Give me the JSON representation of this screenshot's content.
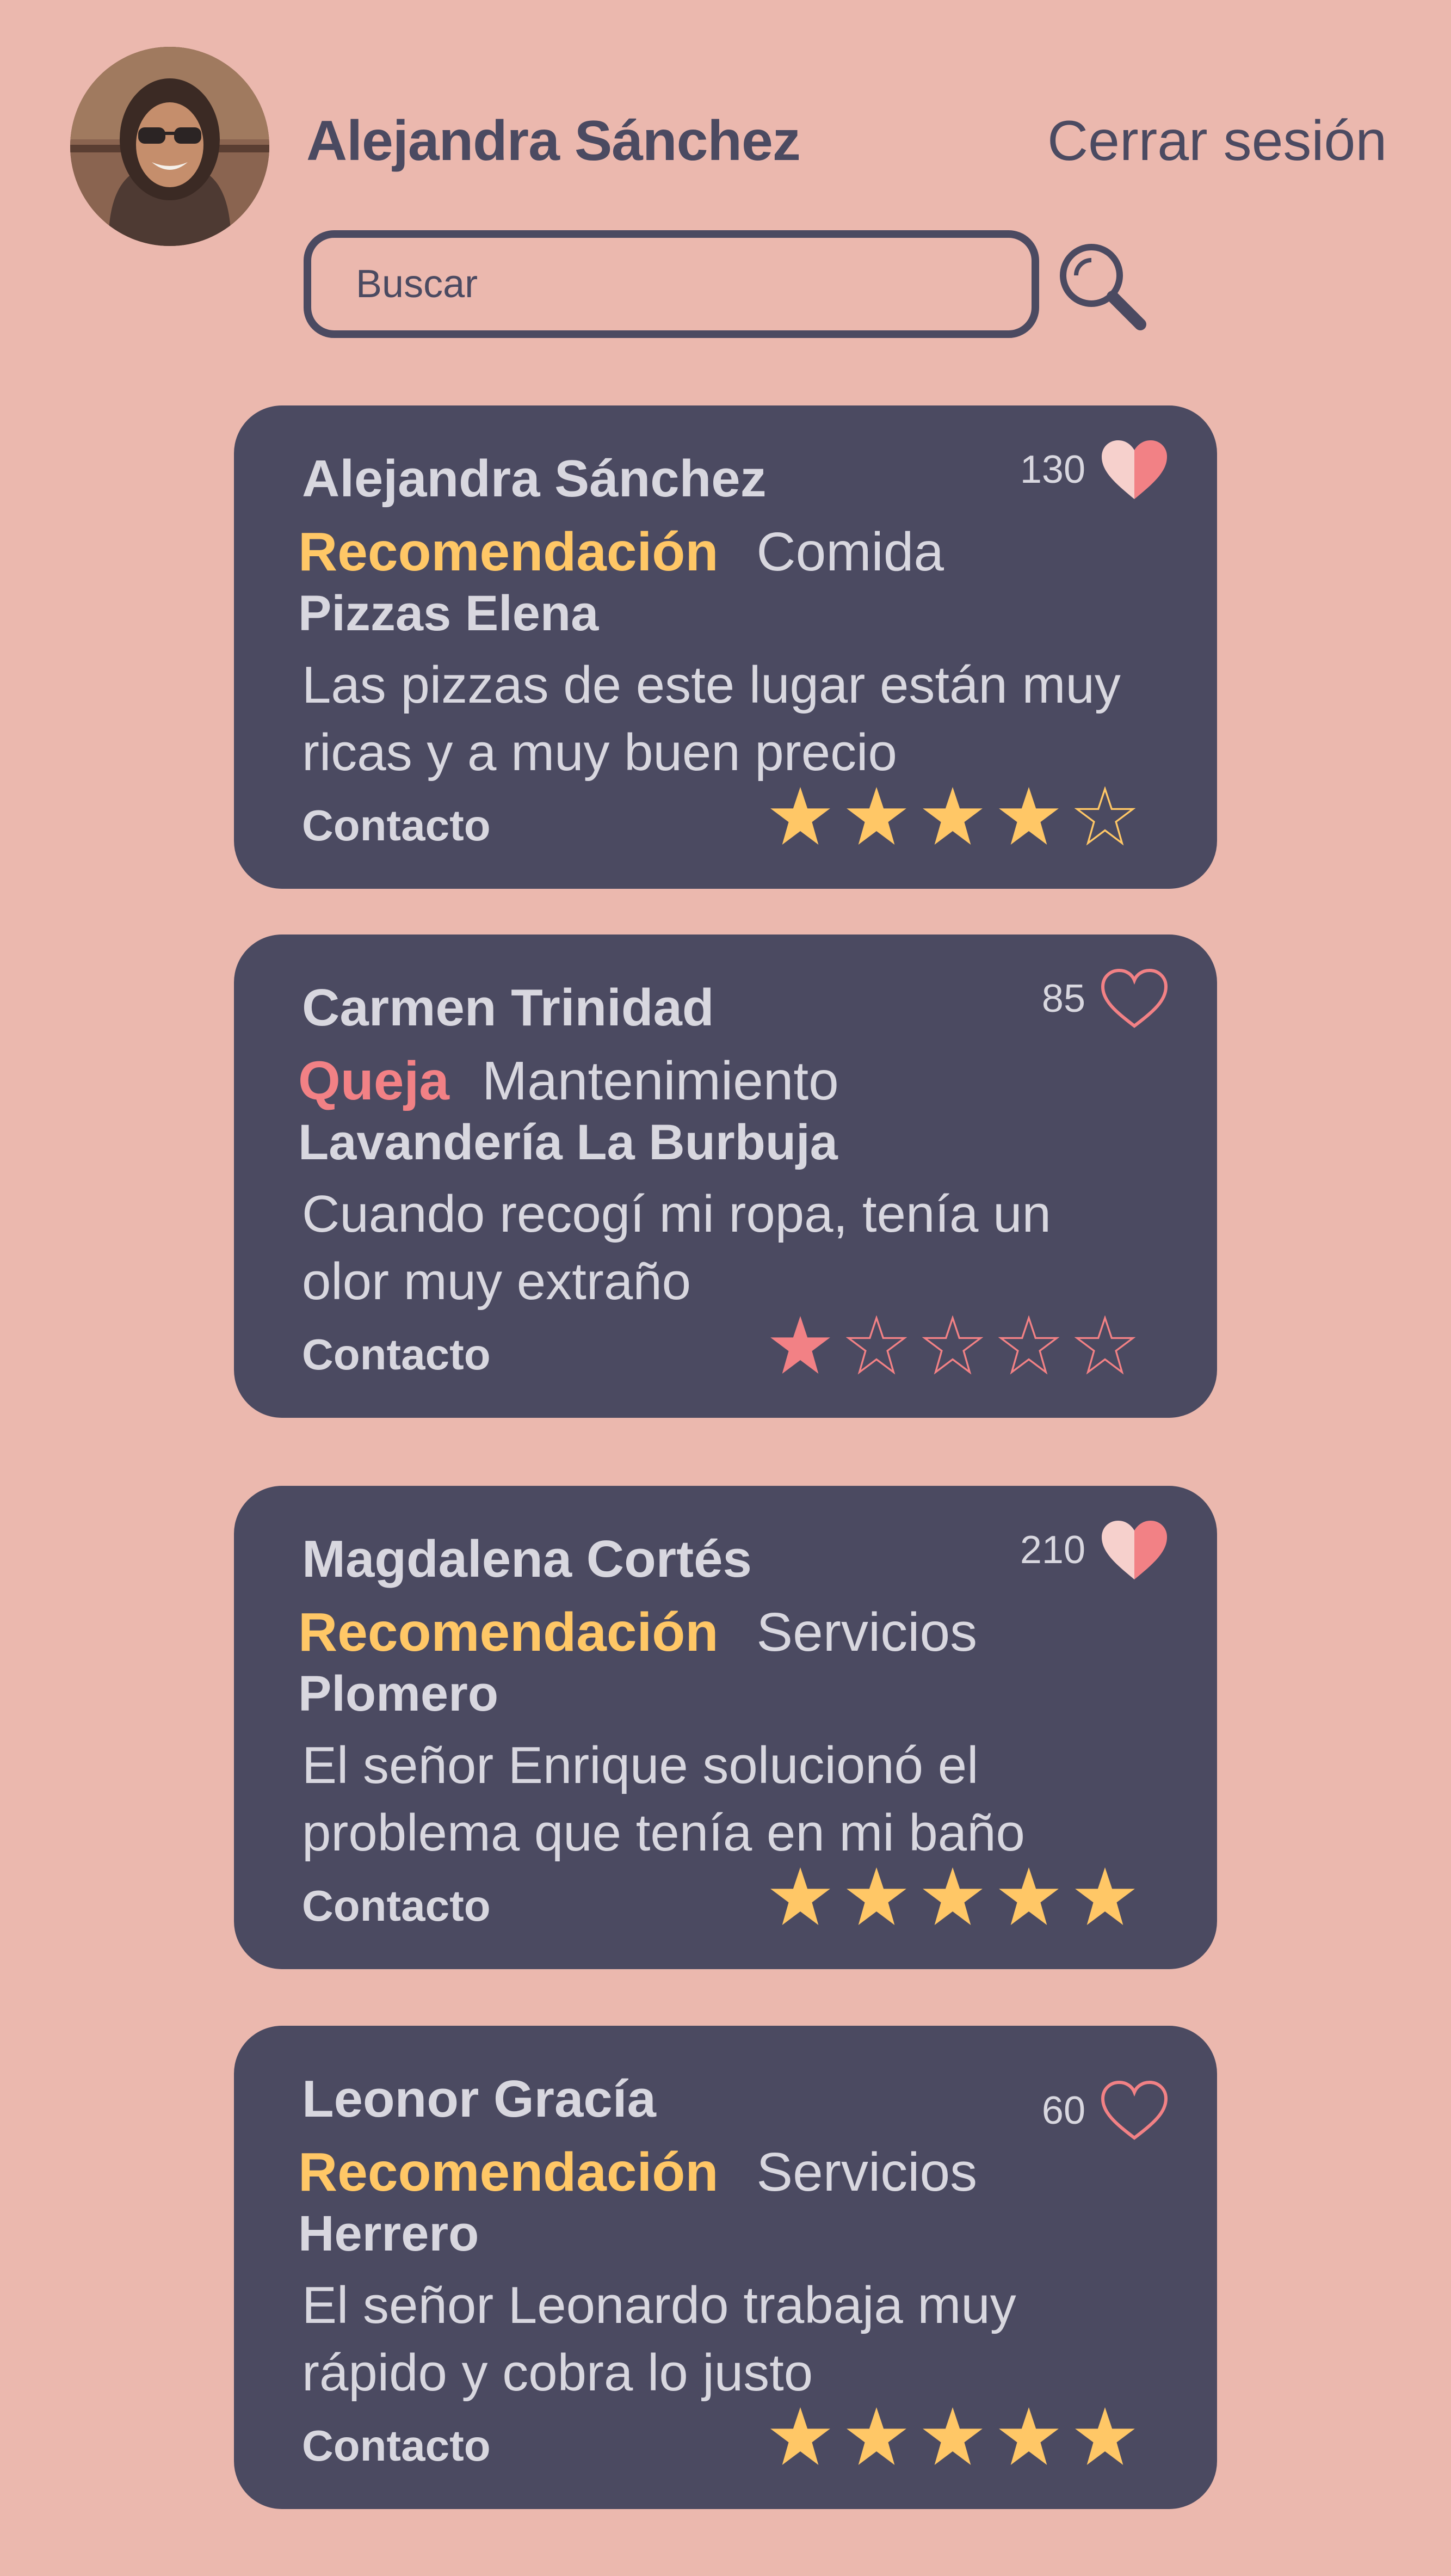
{
  "header": {
    "user_name": "Alejandra Sánchez",
    "logout_label": "Cerrar sesión"
  },
  "search": {
    "placeholder": "Buscar"
  },
  "colors": {
    "background": "#ebb8ae",
    "card": "#4b4a61",
    "recommendation": "#ffc766",
    "complaint": "#f28185",
    "card_text": "#d8d7df"
  },
  "posts": [
    {
      "author": "Alejandra Sánchez",
      "likes": "130",
      "liked": true,
      "type": "Recomendación",
      "category": "Comida",
      "business": "Pizzas Elena",
      "text": "Las pizzas de este lugar están muy ricas y a muy buen precio",
      "contact_label": "Contacto",
      "rating": 4
    },
    {
      "author": "Carmen Trinidad",
      "likes": "85",
      "liked": false,
      "type": "Queja",
      "category": "Mantenimiento",
      "business": "Lavandería La Burbuja",
      "text": "Cuando recogí mi ropa, tenía un olor muy extraño",
      "contact_label": "Contacto",
      "rating": 1
    },
    {
      "author": "Magdalena Cortés",
      "likes": "210",
      "liked": true,
      "type": "Recomendación",
      "category": "Servicios",
      "business": "Plomero",
      "text": "El señor Enrique solucionó el problema que tenía en mi baño",
      "contact_label": "Contacto",
      "rating": 5
    },
    {
      "author": "Leonor Gracía",
      "likes": "60",
      "liked": false,
      "type": "Recomendación",
      "category": "Servicios",
      "business": "Herrero",
      "text": "El señor Leonardo trabaja muy rápido y cobra lo justo",
      "contact_label": "Contacto",
      "rating": 5
    }
  ]
}
